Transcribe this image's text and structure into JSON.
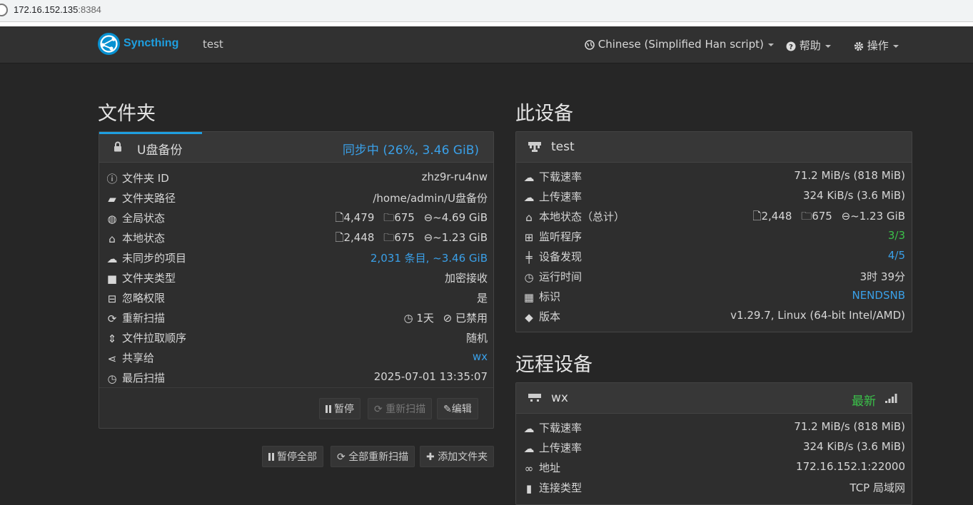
{
  "browser": {
    "url_host": "172.16.152.135",
    "url_port": ":8384"
  },
  "navbar": {
    "brand": "Syncthing",
    "device_name": "test",
    "language": "Chinese (Simplified Han script)",
    "help": "帮助",
    "actions": "操作"
  },
  "folders": {
    "heading": "文件夹",
    "folder": {
      "name": "U盘备份",
      "status": "同步中 (26%, 3.46 GiB)",
      "progress": 0.26,
      "rows": [
        {
          "label": "文件夹 ID",
          "value": "zhz9r-ru4nw"
        },
        {
          "label": "文件夹路径",
          "value": "/home/admin/U盘备份"
        },
        {
          "label": "全局状态",
          "files": "4,479",
          "dirs": "675",
          "size": "~4.69 GiB"
        },
        {
          "label": "本地状态",
          "files": "2,448",
          "dirs": "675",
          "size": "~1.23 GiB"
        },
        {
          "label": "未同步的项目",
          "value": "2,031 条目, ~3.46 GiB"
        },
        {
          "label": "文件夹类型",
          "value": "加密接收"
        },
        {
          "label": "忽略权限",
          "value": "是"
        },
        {
          "label": "重新扫描",
          "interval": "1天",
          "watch": "已禁用"
        },
        {
          "label": "文件拉取顺序",
          "value": "随机"
        },
        {
          "label": "共享给",
          "value": "wx"
        },
        {
          "label": "最后扫描",
          "value": "2025-07-01 13:35:07"
        }
      ],
      "buttons": {
        "pause": "暂停",
        "rescan": "重新扫描",
        "edit": "编辑"
      }
    },
    "bottom_buttons": {
      "pause_all": "暂停全部",
      "rescan_all": "全部重新扫描",
      "add_folder": "添加文件夹"
    }
  },
  "this_device": {
    "heading": "此设备",
    "name": "test",
    "rows": [
      {
        "label": "下载速率",
        "value": "71.2 MiB/s (818 MiB)"
      },
      {
        "label": "上传速率",
        "value": "324 KiB/s (3.6 MiB)"
      },
      {
        "label": "本地状态（总计）",
        "files": "2,448",
        "dirs": "675",
        "size": "~1.23 GiB"
      },
      {
        "label": "监听程序",
        "value": "3/3"
      },
      {
        "label": "设备发现",
        "value": "4/5"
      },
      {
        "label": "运行时间",
        "value": "3时 39分"
      },
      {
        "label": "标识",
        "value": "NENDSNB"
      },
      {
        "label": "版本",
        "value": "v1.29.7, Linux (64-bit Intel/AMD)"
      }
    ]
  },
  "remote_devices": {
    "heading": "远程设备",
    "device": {
      "name": "wx",
      "status": "最新",
      "rows": [
        {
          "label": "下载速率",
          "value": "71.2 MiB/s (818 MiB)"
        },
        {
          "label": "上传速率",
          "value": "324 KiB/s (3.6 MiB)"
        },
        {
          "label": "地址",
          "value": "172.16.152.1:22000"
        },
        {
          "label": "连接类型",
          "value": "TCP 局域网"
        }
      ]
    }
  },
  "colors": {
    "accent": "#1e9fe0",
    "link": "#3aa0e8",
    "ok": "#3bc24a",
    "background": "#262626"
  }
}
